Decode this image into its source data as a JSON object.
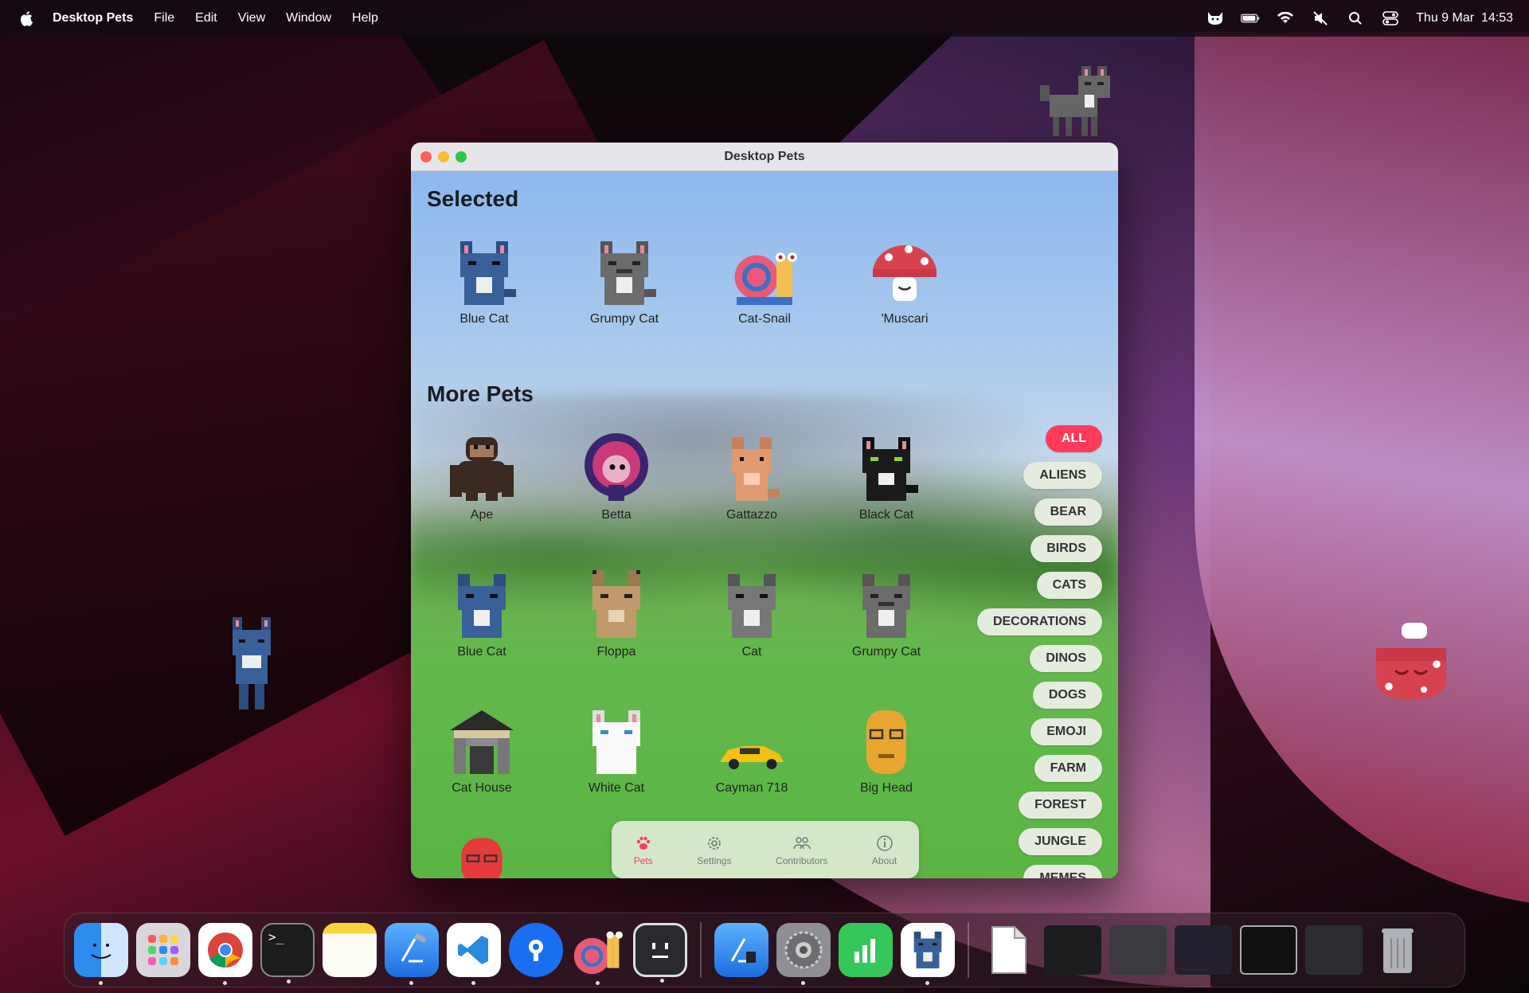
{
  "menubar": {
    "app_name": "Desktop Pets",
    "menus": [
      "File",
      "Edit",
      "View",
      "Window",
      "Help"
    ],
    "clock": "Thu 9 Mar  14:53"
  },
  "window": {
    "title": "Desktop Pets",
    "selected_heading": "Selected",
    "more_heading": "More Pets",
    "selected": [
      {
        "name": "Blue Cat",
        "icon": "blue-cat-sprite"
      },
      {
        "name": "Grumpy Cat",
        "icon": "grumpy-cat-sprite"
      },
      {
        "name": "Cat-Snail",
        "icon": "cat-snail-sprite"
      },
      {
        "name": "'Muscari",
        "icon": "mushroom-sprite"
      }
    ],
    "more": [
      {
        "name": "Ape"
      },
      {
        "name": "Betta"
      },
      {
        "name": "Gattazzo"
      },
      {
        "name": "Black Cat"
      },
      {
        "name": "Blue Cat"
      },
      {
        "name": "Floppa"
      },
      {
        "name": "Cat"
      },
      {
        "name": "Grumpy Cat"
      },
      {
        "name": "Cat House"
      },
      {
        "name": "White Cat"
      },
      {
        "name": "Cayman 718"
      },
      {
        "name": "Big Head"
      }
    ],
    "filters": [
      "ALL",
      "ALIENS",
      "BEAR",
      "BIRDS",
      "CATS",
      "DECORATIONS",
      "DINOS",
      "DOGS",
      "EMOJI",
      "FARM",
      "FOREST",
      "JUNGLE",
      "MEMES"
    ],
    "active_filter": "ALL",
    "tabs": [
      {
        "label": "Pets",
        "icon": "paw-icon",
        "active": true
      },
      {
        "label": "Settings",
        "icon": "gear-icon",
        "active": false
      },
      {
        "label": "Contributors",
        "icon": "people-icon",
        "active": false
      },
      {
        "label": "About",
        "icon": "info-icon",
        "active": false
      }
    ]
  },
  "colors": {
    "accent": "#ff3b5c",
    "title_bar": "#e6e6ea"
  },
  "dock": {
    "apps": [
      "finder-icon",
      "launchpad-icon",
      "chrome-icon",
      "terminal-icon",
      "notes-icon",
      "xcode-icon",
      "vscode-icon",
      "proxyman-icon",
      "cat-snail-app-icon",
      "pixel-app-icon",
      "xcode-instruments-icon",
      "system-settings-icon",
      "numbers-icon",
      "desktop-pets-icon",
      "file-icon",
      "trash-icon"
    ]
  }
}
